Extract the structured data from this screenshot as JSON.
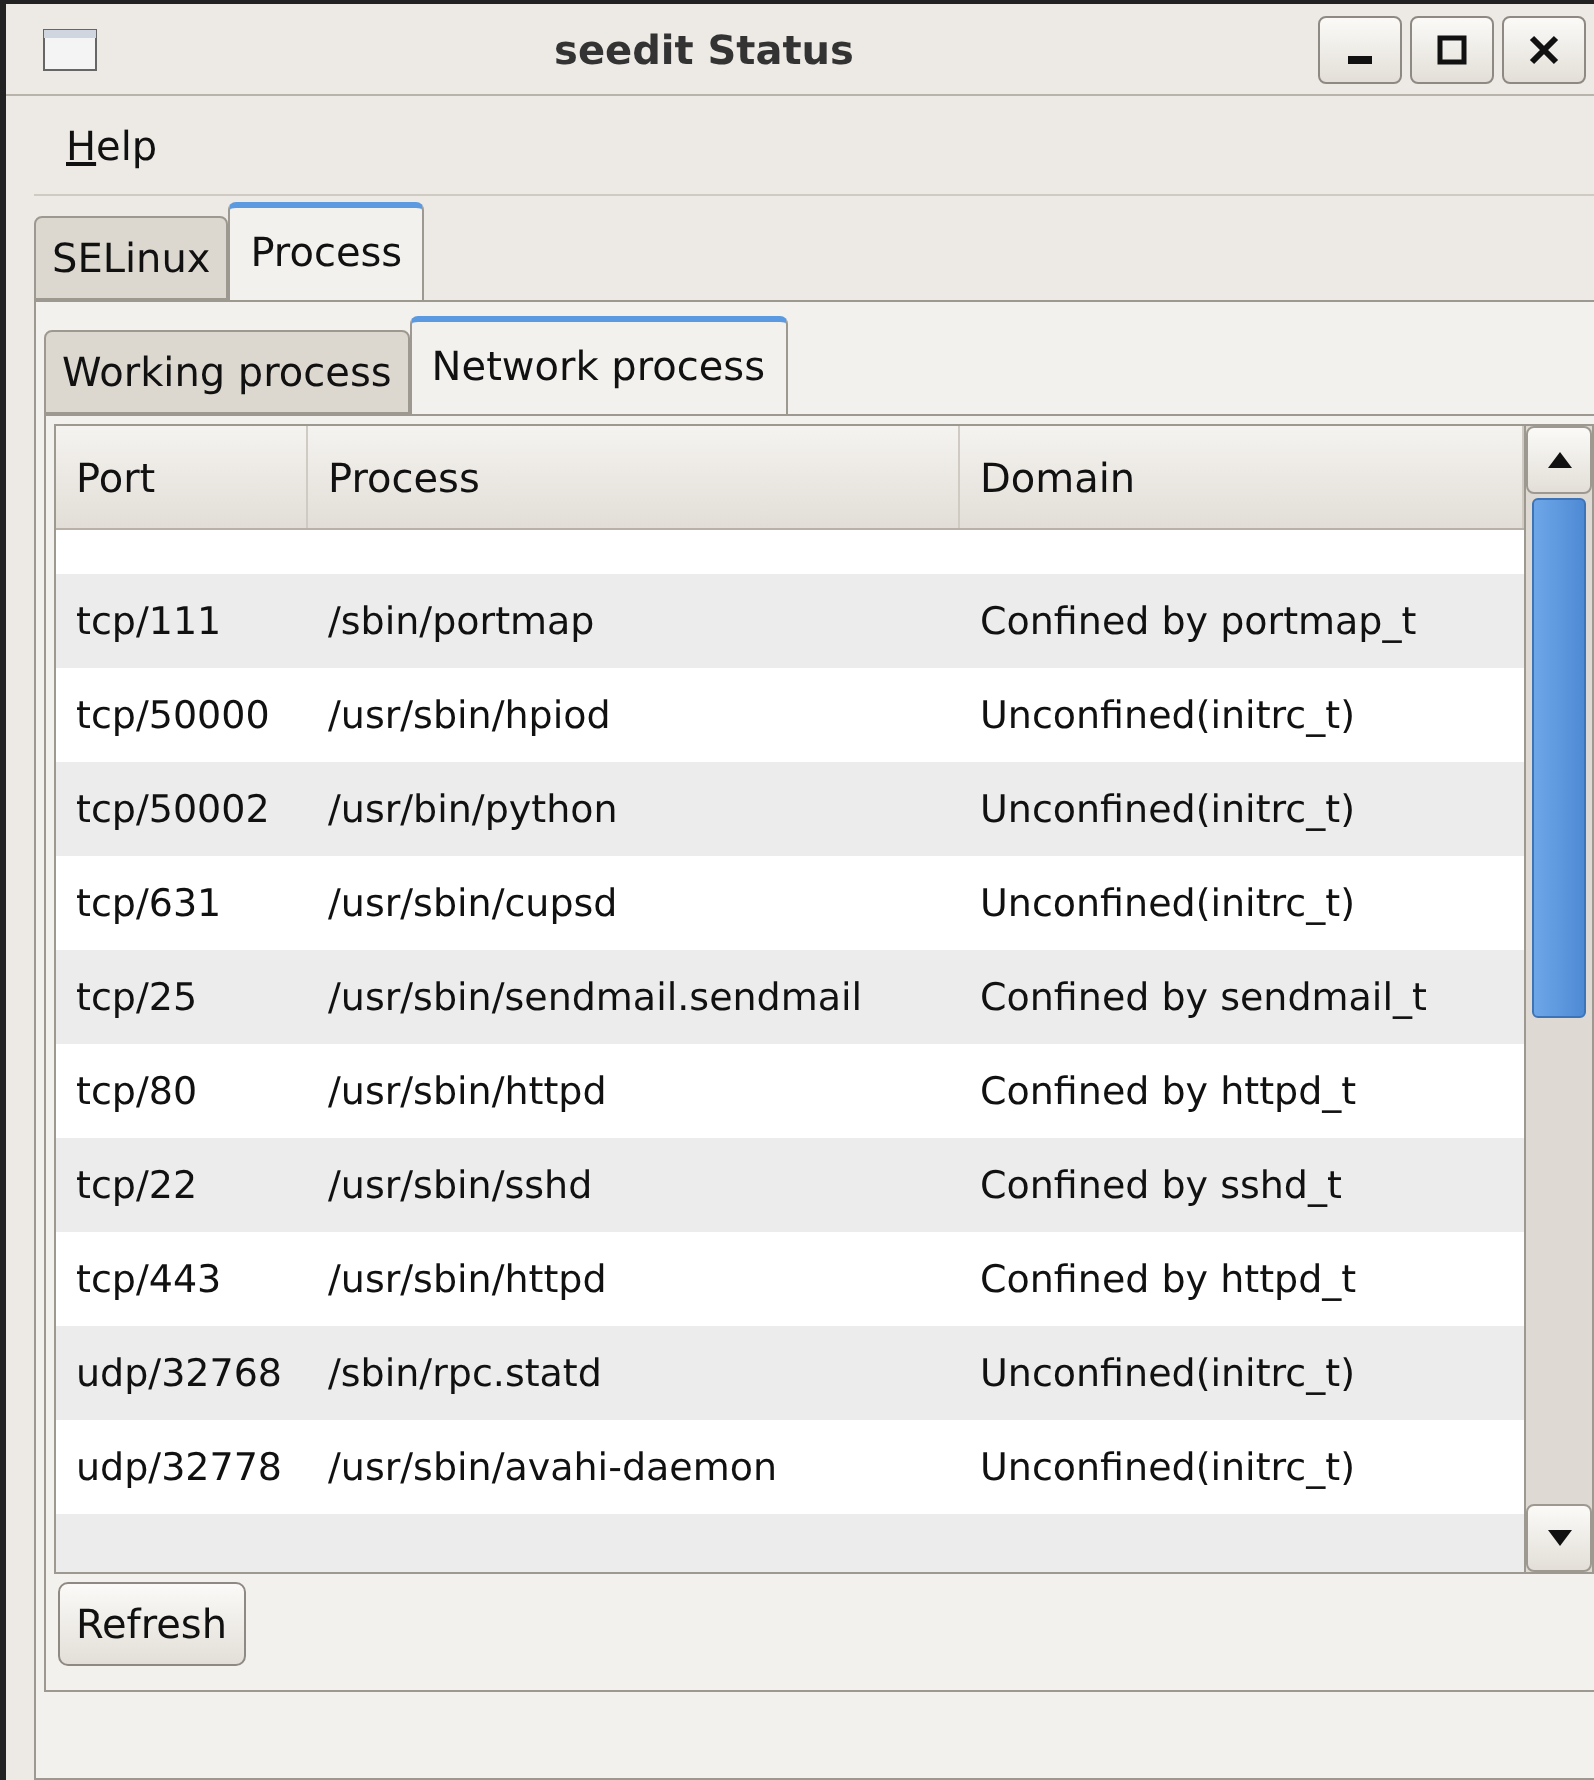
{
  "window": {
    "title": "seedit Status"
  },
  "menu": [
    {
      "label": "Help"
    }
  ],
  "tabs": [
    {
      "label": "SELinux",
      "selected": false
    },
    {
      "label": "Process",
      "selected": true
    }
  ],
  "subtabs": [
    {
      "label": "Working process",
      "selected": false
    },
    {
      "label": "Network process",
      "selected": true
    }
  ],
  "table": {
    "columns": [
      "Port",
      "Process",
      "Domain"
    ],
    "rows": [
      [
        "tcp/111",
        "/sbin/portmap",
        "Confined by portmap_t"
      ],
      [
        "tcp/50000",
        "/usr/sbin/hpiod",
        "Unconfined(initrc_t)"
      ],
      [
        "tcp/50002",
        "/usr/bin/python",
        "Unconfined(initrc_t)"
      ],
      [
        "tcp/631",
        "/usr/sbin/cupsd",
        "Unconfined(initrc_t)"
      ],
      [
        "tcp/25",
        "/usr/sbin/sendmail.sendmail",
        "Confined by sendmail_t"
      ],
      [
        "tcp/80",
        "/usr/sbin/httpd",
        "Confined by httpd_t"
      ],
      [
        "tcp/22",
        "/usr/sbin/sshd",
        "Confined by sshd_t"
      ],
      [
        "tcp/443",
        "/usr/sbin/httpd",
        "Confined by httpd_t"
      ],
      [
        "udp/32768",
        "/sbin/rpc.statd",
        "Unconfined(initrc_t)"
      ],
      [
        "udp/32778",
        "/usr/sbin/avahi-daemon",
        "Unconfined(initrc_t)"
      ]
    ]
  },
  "buttons": [
    "Refresh"
  ]
}
